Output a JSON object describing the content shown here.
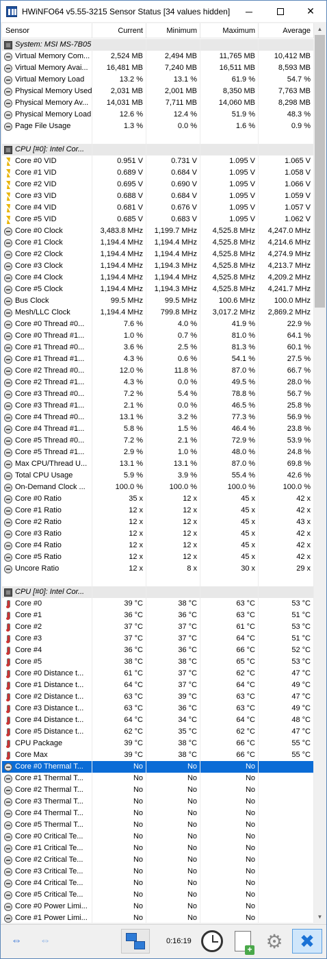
{
  "window": {
    "title": "HWiNFO64 v5.55-3215 Sensor Status [34 values hidden]",
    "minimize": "─",
    "maximize": "",
    "close": "✕"
  },
  "columns": [
    "Sensor",
    "Current",
    "Minimum",
    "Maximum",
    "Average"
  ],
  "rows": [
    {
      "type": "group",
      "icon": "chip-icon",
      "name": "System: MSI MS-7B05",
      "v": [
        "",
        "",
        "",
        ""
      ]
    },
    {
      "type": "data",
      "icon": "clock-icon",
      "name": "Virtual Memory Com...",
      "v": [
        "2,524 MB",
        "2,494 MB",
        "11,765 MB",
        "10,412 MB"
      ]
    },
    {
      "type": "data",
      "icon": "clock-icon",
      "name": "Virtual Memory Avai...",
      "v": [
        "16,481 MB",
        "7,240 MB",
        "16,511 MB",
        "8,593 MB"
      ]
    },
    {
      "type": "data",
      "icon": "clock-icon",
      "name": "Virtual Memory Load",
      "v": [
        "13.2 %",
        "13.1 %",
        "61.9 %",
        "54.7 %"
      ]
    },
    {
      "type": "data",
      "icon": "clock-icon",
      "name": "Physical Memory Used",
      "v": [
        "2,031 MB",
        "2,001 MB",
        "8,350 MB",
        "7,763 MB"
      ]
    },
    {
      "type": "data",
      "icon": "clock-icon",
      "name": "Physical Memory Av...",
      "v": [
        "14,031 MB",
        "7,711 MB",
        "14,060 MB",
        "8,298 MB"
      ]
    },
    {
      "type": "data",
      "icon": "clock-icon",
      "name": "Physical Memory Load",
      "v": [
        "12.6 %",
        "12.4 %",
        "51.9 %",
        "48.3 %"
      ]
    },
    {
      "type": "data",
      "icon": "clock-icon",
      "name": "Page File Usage",
      "v": [
        "1.3 %",
        "0.0 %",
        "1.6 %",
        "0.9 %"
      ]
    },
    {
      "type": "blank",
      "icon": "",
      "name": "",
      "v": [
        "",
        "",
        "",
        ""
      ]
    },
    {
      "type": "group",
      "icon": "chip-icon",
      "name": "CPU [#0]: Intel Cor...",
      "v": [
        "",
        "",
        "",
        ""
      ]
    },
    {
      "type": "data",
      "icon": "voltage-icon",
      "name": "Core #0 VID",
      "v": [
        "0.951 V",
        "0.731 V",
        "1.095 V",
        "1.065 V"
      ]
    },
    {
      "type": "data",
      "icon": "voltage-icon",
      "name": "Core #1 VID",
      "v": [
        "0.689 V",
        "0.684 V",
        "1.095 V",
        "1.058 V"
      ]
    },
    {
      "type": "data",
      "icon": "voltage-icon",
      "name": "Core #2 VID",
      "v": [
        "0.695 V",
        "0.690 V",
        "1.095 V",
        "1.066 V"
      ]
    },
    {
      "type": "data",
      "icon": "voltage-icon",
      "name": "Core #3 VID",
      "v": [
        "0.688 V",
        "0.684 V",
        "1.095 V",
        "1.059 V"
      ]
    },
    {
      "type": "data",
      "icon": "voltage-icon",
      "name": "Core #4 VID",
      "v": [
        "0.681 V",
        "0.676 V",
        "1.095 V",
        "1.057 V"
      ]
    },
    {
      "type": "data",
      "icon": "voltage-icon",
      "name": "Core #5 VID",
      "v": [
        "0.685 V",
        "0.683 V",
        "1.095 V",
        "1.062 V"
      ]
    },
    {
      "type": "data",
      "icon": "clock-icon",
      "name": "Core #0 Clock",
      "v": [
        "3,483.8 MHz",
        "1,199.7 MHz",
        "4,525.8 MHz",
        "4,247.0 MHz"
      ]
    },
    {
      "type": "data",
      "icon": "clock-icon",
      "name": "Core #1 Clock",
      "v": [
        "1,194.4 MHz",
        "1,194.4 MHz",
        "4,525.8 MHz",
        "4,214.6 MHz"
      ]
    },
    {
      "type": "data",
      "icon": "clock-icon",
      "name": "Core #2 Clock",
      "v": [
        "1,194.4 MHz",
        "1,194.4 MHz",
        "4,525.8 MHz",
        "4,274.9 MHz"
      ]
    },
    {
      "type": "data",
      "icon": "clock-icon",
      "name": "Core #3 Clock",
      "v": [
        "1,194.4 MHz",
        "1,194.3 MHz",
        "4,525.8 MHz",
        "4,213.7 MHz"
      ]
    },
    {
      "type": "data",
      "icon": "clock-icon",
      "name": "Core #4 Clock",
      "v": [
        "1,194.4 MHz",
        "1,194.4 MHz",
        "4,525.8 MHz",
        "4,209.2 MHz"
      ]
    },
    {
      "type": "data",
      "icon": "clock-icon",
      "name": "Core #5 Clock",
      "v": [
        "1,194.4 MHz",
        "1,194.3 MHz",
        "4,525.8 MHz",
        "4,241.7 MHz"
      ]
    },
    {
      "type": "data",
      "icon": "clock-icon",
      "name": "Bus Clock",
      "v": [
        "99.5 MHz",
        "99.5 MHz",
        "100.6 MHz",
        "100.0 MHz"
      ]
    },
    {
      "type": "data",
      "icon": "clock-icon",
      "name": "Mesh/LLC Clock",
      "v": [
        "1,194.4 MHz",
        "799.8 MHz",
        "3,017.2 MHz",
        "2,869.2 MHz"
      ]
    },
    {
      "type": "data",
      "icon": "clock-icon",
      "name": "Core #0 Thread #0...",
      "v": [
        "7.6 %",
        "4.0 %",
        "41.9 %",
        "22.9 %"
      ]
    },
    {
      "type": "data",
      "icon": "clock-icon",
      "name": "Core #0 Thread #1...",
      "v": [
        "1.0 %",
        "0.7 %",
        "81.0 %",
        "64.1 %"
      ]
    },
    {
      "type": "data",
      "icon": "clock-icon",
      "name": "Core #1 Thread #0...",
      "v": [
        "3.6 %",
        "2.5 %",
        "81.3 %",
        "60.1 %"
      ]
    },
    {
      "type": "data",
      "icon": "clock-icon",
      "name": "Core #1 Thread #1...",
      "v": [
        "4.3 %",
        "0.6 %",
        "54.1 %",
        "27.5 %"
      ]
    },
    {
      "type": "data",
      "icon": "clock-icon",
      "name": "Core #2 Thread #0...",
      "v": [
        "12.0 %",
        "11.8 %",
        "87.0 %",
        "66.7 %"
      ]
    },
    {
      "type": "data",
      "icon": "clock-icon",
      "name": "Core #2 Thread #1...",
      "v": [
        "4.3 %",
        "0.0 %",
        "49.5 %",
        "28.0 %"
      ]
    },
    {
      "type": "data",
      "icon": "clock-icon",
      "name": "Core #3 Thread #0...",
      "v": [
        "7.2 %",
        "5.4 %",
        "78.8 %",
        "56.7 %"
      ]
    },
    {
      "type": "data",
      "icon": "clock-icon",
      "name": "Core #3 Thread #1...",
      "v": [
        "2.1 %",
        "0.0 %",
        "46.5 %",
        "25.8 %"
      ]
    },
    {
      "type": "data",
      "icon": "clock-icon",
      "name": "Core #4 Thread #0...",
      "v": [
        "13.1 %",
        "3.2 %",
        "77.3 %",
        "56.9 %"
      ]
    },
    {
      "type": "data",
      "icon": "clock-icon",
      "name": "Core #4 Thread #1...",
      "v": [
        "5.8 %",
        "1.5 %",
        "46.4 %",
        "23.8 %"
      ]
    },
    {
      "type": "data",
      "icon": "clock-icon",
      "name": "Core #5 Thread #0...",
      "v": [
        "7.2 %",
        "2.1 %",
        "72.9 %",
        "53.9 %"
      ]
    },
    {
      "type": "data",
      "icon": "clock-icon",
      "name": "Core #5 Thread #1...",
      "v": [
        "2.9 %",
        "1.0 %",
        "48.0 %",
        "24.8 %"
      ]
    },
    {
      "type": "data",
      "icon": "clock-icon",
      "name": "Max CPU/Thread U...",
      "v": [
        "13.1 %",
        "13.1 %",
        "87.0 %",
        "69.8 %"
      ]
    },
    {
      "type": "data",
      "icon": "clock-icon",
      "name": "Total CPU Usage",
      "v": [
        "5.9 %",
        "3.9 %",
        "55.4 %",
        "42.6 %"
      ]
    },
    {
      "type": "data",
      "icon": "clock-icon",
      "name": "On-Demand Clock ...",
      "v": [
        "100.0 %",
        "100.0 %",
        "100.0 %",
        "100.0 %"
      ]
    },
    {
      "type": "data",
      "icon": "clock-icon",
      "name": "Core #0 Ratio",
      "v": [
        "35 x",
        "12 x",
        "45 x",
        "42 x"
      ]
    },
    {
      "type": "data",
      "icon": "clock-icon",
      "name": "Core #1 Ratio",
      "v": [
        "12 x",
        "12 x",
        "45 x",
        "42 x"
      ]
    },
    {
      "type": "data",
      "icon": "clock-icon",
      "name": "Core #2 Ratio",
      "v": [
        "12 x",
        "12 x",
        "45 x",
        "43 x"
      ]
    },
    {
      "type": "data",
      "icon": "clock-icon",
      "name": "Core #3 Ratio",
      "v": [
        "12 x",
        "12 x",
        "45 x",
        "42 x"
      ]
    },
    {
      "type": "data",
      "icon": "clock-icon",
      "name": "Core #4 Ratio",
      "v": [
        "12 x",
        "12 x",
        "45 x",
        "42 x"
      ]
    },
    {
      "type": "data",
      "icon": "clock-icon",
      "name": "Core #5 Ratio",
      "v": [
        "12 x",
        "12 x",
        "45 x",
        "42 x"
      ]
    },
    {
      "type": "data",
      "icon": "clock-icon",
      "name": "Uncore Ratio",
      "v": [
        "12 x",
        "8 x",
        "30 x",
        "29 x"
      ]
    },
    {
      "type": "blank",
      "icon": "",
      "name": "",
      "v": [
        "",
        "",
        "",
        ""
      ]
    },
    {
      "type": "group",
      "icon": "chip-icon",
      "name": "CPU [#0]: Intel Cor...",
      "v": [
        "",
        "",
        "",
        ""
      ]
    },
    {
      "type": "data",
      "icon": "thermometer-icon",
      "name": "Core #0",
      "v": [
        "39 °C",
        "38 °C",
        "63 °C",
        "53 °C"
      ]
    },
    {
      "type": "data",
      "icon": "thermometer-icon",
      "name": "Core #1",
      "v": [
        "36 °C",
        "36 °C",
        "63 °C",
        "51 °C"
      ]
    },
    {
      "type": "data",
      "icon": "thermometer-icon",
      "name": "Core #2",
      "v": [
        "37 °C",
        "37 °C",
        "61 °C",
        "53 °C"
      ]
    },
    {
      "type": "data",
      "icon": "thermometer-icon",
      "name": "Core #3",
      "v": [
        "37 °C",
        "37 °C",
        "64 °C",
        "51 °C"
      ]
    },
    {
      "type": "data",
      "icon": "thermometer-icon",
      "name": "Core #4",
      "v": [
        "36 °C",
        "36 °C",
        "66 °C",
        "52 °C"
      ]
    },
    {
      "type": "data",
      "icon": "thermometer-icon",
      "name": "Core #5",
      "v": [
        "38 °C",
        "38 °C",
        "65 °C",
        "53 °C"
      ]
    },
    {
      "type": "data",
      "icon": "thermometer-icon",
      "name": "Core #0 Distance t...",
      "v": [
        "61 °C",
        "37 °C",
        "62 °C",
        "47 °C"
      ]
    },
    {
      "type": "data",
      "icon": "thermometer-icon",
      "name": "Core #1 Distance t...",
      "v": [
        "64 °C",
        "37 °C",
        "64 °C",
        "49 °C"
      ]
    },
    {
      "type": "data",
      "icon": "thermometer-icon",
      "name": "Core #2 Distance t...",
      "v": [
        "63 °C",
        "39 °C",
        "63 °C",
        "47 °C"
      ]
    },
    {
      "type": "data",
      "icon": "thermometer-icon",
      "name": "Core #3 Distance t...",
      "v": [
        "63 °C",
        "36 °C",
        "63 °C",
        "49 °C"
      ]
    },
    {
      "type": "data",
      "icon": "thermometer-icon",
      "name": "Core #4 Distance t...",
      "v": [
        "64 °C",
        "34 °C",
        "64 °C",
        "48 °C"
      ]
    },
    {
      "type": "data",
      "icon": "thermometer-icon",
      "name": "Core #5 Distance t...",
      "v": [
        "62 °C",
        "35 °C",
        "62 °C",
        "47 °C"
      ]
    },
    {
      "type": "data",
      "icon": "thermometer-icon",
      "name": "CPU Package",
      "v": [
        "39 °C",
        "38 °C",
        "66 °C",
        "55 °C"
      ]
    },
    {
      "type": "data",
      "icon": "thermometer-icon",
      "name": "Core Max",
      "v": [
        "39 °C",
        "38 °C",
        "66 °C",
        "55 °C"
      ]
    },
    {
      "type": "selected",
      "icon": "clock-icon",
      "name": "Core #0 Thermal T...",
      "v": [
        "No",
        "No",
        "No",
        ""
      ]
    },
    {
      "type": "data",
      "icon": "clock-icon",
      "name": "Core #1 Thermal T...",
      "v": [
        "No",
        "No",
        "No",
        ""
      ]
    },
    {
      "type": "data",
      "icon": "clock-icon",
      "name": "Core #2 Thermal T...",
      "v": [
        "No",
        "No",
        "No",
        ""
      ]
    },
    {
      "type": "data",
      "icon": "clock-icon",
      "name": "Core #3 Thermal T...",
      "v": [
        "No",
        "No",
        "No",
        ""
      ]
    },
    {
      "type": "data",
      "icon": "clock-icon",
      "name": "Core #4 Thermal T...",
      "v": [
        "No",
        "No",
        "No",
        ""
      ]
    },
    {
      "type": "data",
      "icon": "clock-icon",
      "name": "Core #5 Thermal T...",
      "v": [
        "No",
        "No",
        "No",
        ""
      ]
    },
    {
      "type": "data",
      "icon": "clock-icon",
      "name": "Core #0 Critical Te...",
      "v": [
        "No",
        "No",
        "No",
        ""
      ]
    },
    {
      "type": "data",
      "icon": "clock-icon",
      "name": "Core #1 Critical Te...",
      "v": [
        "No",
        "No",
        "No",
        ""
      ]
    },
    {
      "type": "data",
      "icon": "clock-icon",
      "name": "Core #2 Critical Te...",
      "v": [
        "No",
        "No",
        "No",
        ""
      ]
    },
    {
      "type": "data",
      "icon": "clock-icon",
      "name": "Core #3 Critical Te...",
      "v": [
        "No",
        "No",
        "No",
        ""
      ]
    },
    {
      "type": "data",
      "icon": "clock-icon",
      "name": "Core #4 Critical Te...",
      "v": [
        "No",
        "No",
        "No",
        ""
      ]
    },
    {
      "type": "data",
      "icon": "clock-icon",
      "name": "Core #5 Critical Te...",
      "v": [
        "No",
        "No",
        "No",
        ""
      ]
    },
    {
      "type": "data",
      "icon": "clock-icon",
      "name": "Core #0 Power Limi...",
      "v": [
        "No",
        "No",
        "No",
        ""
      ]
    },
    {
      "type": "data",
      "icon": "clock-icon",
      "name": "Core #1 Power Limi...",
      "v": [
        "No",
        "No",
        "No",
        ""
      ]
    }
  ],
  "toolbar": {
    "timer": "0:16:19",
    "nav_icon": "⇔",
    "nav2_icon": "⇔",
    "settings_icon": "⚙",
    "exit_icon": "✖"
  },
  "colors": {
    "selection": "#0b6cd6",
    "group_bg": "#e8e8e8",
    "exit_accent": "#1a72d6"
  }
}
